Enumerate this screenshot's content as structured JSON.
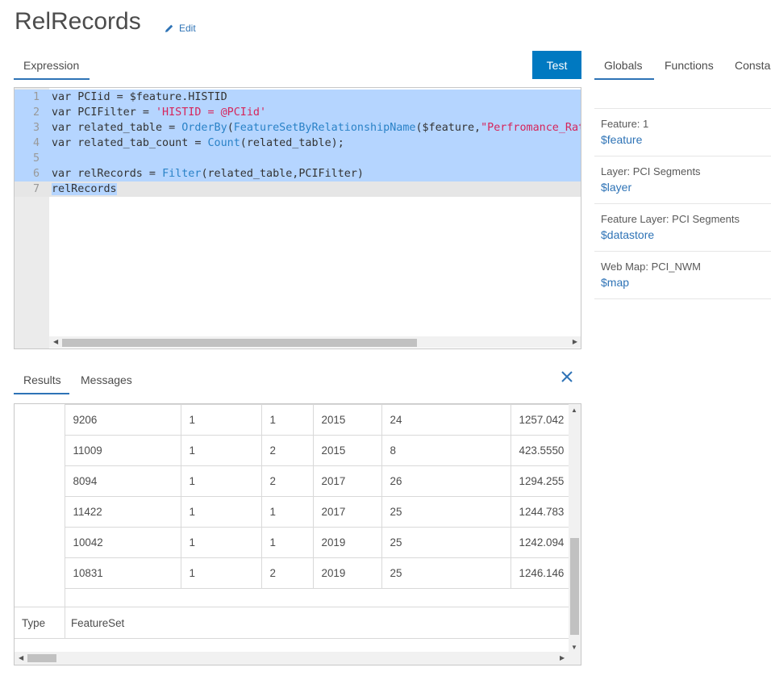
{
  "header": {
    "title": "RelRecords",
    "edit_label": "Edit"
  },
  "editor": {
    "tab_label": "Expression",
    "test_label": "Test",
    "lines": [
      {
        "num": "1",
        "parts": [
          [
            "kw",
            "var PCIid = $feature.HISTID"
          ]
        ]
      },
      {
        "num": "2",
        "parts": [
          [
            "kw",
            "var PCIFilter = "
          ],
          [
            "str",
            "'HISTID = @PCIid'"
          ]
        ]
      },
      {
        "num": "3",
        "parts": [
          [
            "kw",
            "var related_table = "
          ],
          [
            "fn",
            "OrderBy"
          ],
          [
            "kw",
            "("
          ],
          [
            "fn",
            "FeatureSetByRelationshipName"
          ],
          [
            "kw",
            "($feature,"
          ],
          [
            "str",
            "\"Perfromance_Ratings\""
          ],
          [
            "kw",
            ")"
          ]
        ]
      },
      {
        "num": "4",
        "parts": [
          [
            "kw",
            "var related_tab_count = "
          ],
          [
            "fn",
            "Count"
          ],
          [
            "kw",
            "(related_table);"
          ]
        ]
      },
      {
        "num": "5",
        "parts": []
      },
      {
        "num": "6",
        "parts": [
          [
            "kw",
            "var relRecords = "
          ],
          [
            "fn",
            "Filter"
          ],
          [
            "kw",
            "(related_table,PCIFilter)"
          ]
        ]
      },
      {
        "num": "7",
        "parts": [
          [
            "kw",
            "relRecords"
          ]
        ]
      }
    ]
  },
  "sidebar": {
    "tabs": [
      "Globals",
      "Functions",
      "Consta"
    ],
    "items": [
      {
        "label": "Feature: 1",
        "var": "$feature"
      },
      {
        "label": "Layer: PCI Segments",
        "var": "$layer"
      },
      {
        "label": "Feature Layer: PCI Segments",
        "var": "$datastore"
      },
      {
        "label": "Web Map: PCI_NWM",
        "var": "$map"
      }
    ]
  },
  "results": {
    "tabs": [
      "Results",
      "Messages"
    ],
    "rows": [
      [
        "9206",
        "1",
        "1",
        "2015",
        "24",
        "1257.042"
      ],
      [
        "11009",
        "1",
        "2",
        "2015",
        "8",
        "423.5550"
      ],
      [
        "8094",
        "1",
        "2",
        "2017",
        "26",
        "1294.255"
      ],
      [
        "11422",
        "1",
        "1",
        "2017",
        "25",
        "1244.783"
      ],
      [
        "10042",
        "1",
        "1",
        "2019",
        "25",
        "1242.094"
      ],
      [
        "10831",
        "1",
        "2",
        "2019",
        "25",
        "1246.146"
      ]
    ],
    "type_key": "Type",
    "type_value": "FeatureSet"
  }
}
